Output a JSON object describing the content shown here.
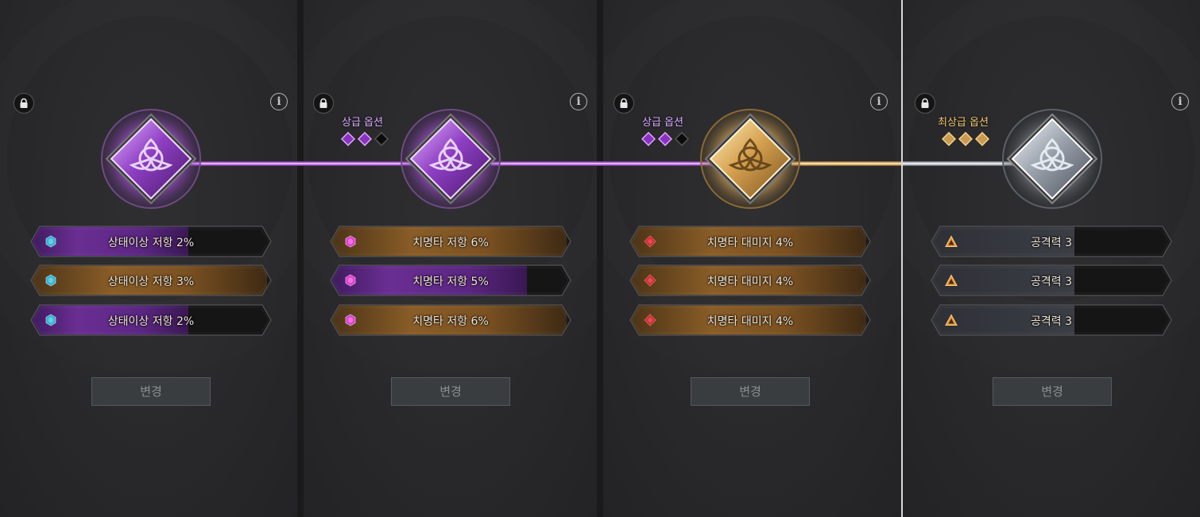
{
  "colors": {
    "purple": "#a74bd6",
    "gold": "#d9a857",
    "silver": "#c9ced6",
    "cyan_gem": "#2fb3d6",
    "magenta_gem": "#e23ad0",
    "red_gem": "#d1252b",
    "orange_gem": "#e8942a"
  },
  "panels": [
    {
      "grade_label": "",
      "pips": [],
      "emblem_color": "purple",
      "stats": [
        {
          "text": "상태이상 저항 2%",
          "fill": "purple",
          "gem": "hexagon-cyan",
          "level": 0.66
        },
        {
          "text": "상태이상 저항 3%",
          "fill": "gold",
          "gem": "hexagon-cyan",
          "level": 1.0
        },
        {
          "text": "상태이상 저항 2%",
          "fill": "purple",
          "gem": "hexagon-cyan",
          "level": 0.66
        }
      ],
      "change_label": "변경"
    },
    {
      "grade_label": "상급 옵션",
      "pips": [
        "purple",
        "purple",
        "empty"
      ],
      "emblem_color": "purple",
      "stats": [
        {
          "text": "치명타 저항 6%",
          "fill": "gold",
          "gem": "hexagon-magenta",
          "level": 1.0
        },
        {
          "text": "치명타 저항 5%",
          "fill": "purple",
          "gem": "hexagon-magenta",
          "level": 0.83
        },
        {
          "text": "치명타 저항 6%",
          "fill": "gold",
          "gem": "hexagon-magenta",
          "level": 1.0
        }
      ],
      "change_label": "변경"
    },
    {
      "grade_label": "상급 옵션",
      "pips": [
        "purple",
        "purple",
        "empty"
      ],
      "emblem_color": "gold",
      "stats": [
        {
          "text": "치명타 대미지 4%",
          "fill": "gold",
          "gem": "diamond-red",
          "level": 1.0
        },
        {
          "text": "치명타 대미지 4%",
          "fill": "gold",
          "gem": "diamond-red",
          "level": 1.0
        },
        {
          "text": "치명타 대미지 4%",
          "fill": "gold",
          "gem": "diamond-red",
          "level": 1.0
        }
      ],
      "change_label": "변경"
    },
    {
      "grade_label": "최상급 옵션",
      "pips": [
        "gold",
        "gold",
        "gold"
      ],
      "emblem_color": "silver",
      "stats": [
        {
          "text": "공격력 3",
          "fill": "gray",
          "gem": "triangle-orange",
          "level": 0.6
        },
        {
          "text": "공격력 3",
          "fill": "gray",
          "gem": "triangle-orange",
          "level": 0.6
        },
        {
          "text": "공격력 3",
          "fill": "gray",
          "gem": "triangle-orange",
          "level": 0.6
        }
      ],
      "change_label": "변경"
    }
  ]
}
